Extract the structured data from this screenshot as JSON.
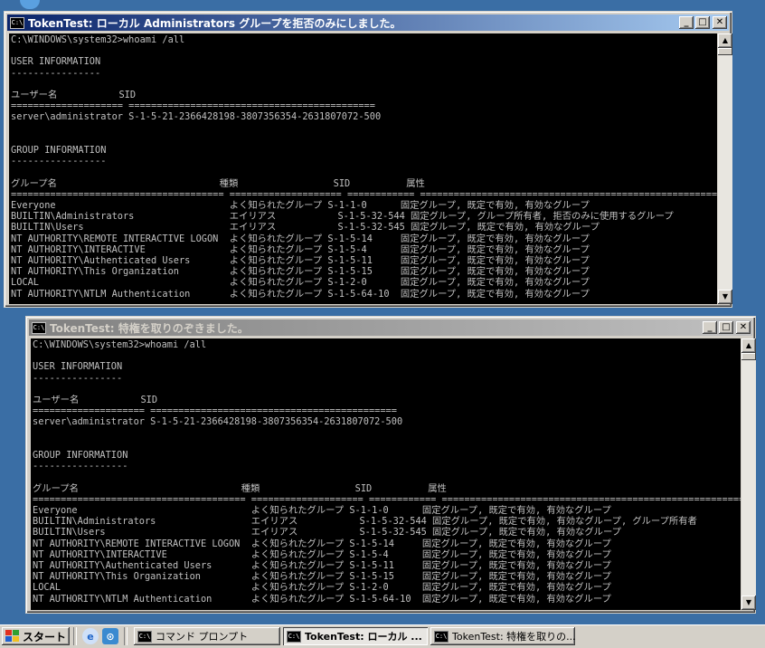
{
  "windows": [
    {
      "title": "TokenTest: ローカル Administrators グループを拒否のみにしました。",
      "active": true,
      "console_text": "C:\\WINDOWS\\system32>whoami /all\n\nUSER INFORMATION\n----------------\n\nユーザー名           SID\n==================== ============================================\nserver\\administrator S-1-5-21-2366428198-3807356354-2631807072-500\n\n\nGROUP INFORMATION\n-----------------\n\nグループ名                             種類                 SID          属性\n====================================== ==================== ============ ========================================================\nEveryone                               よく知られたグループ S-1-1-0      固定グループ, 既定で有効, 有効なグループ\nBUILTIN\\Administrators                 エイリアス           S-1-5-32-544 固定グループ, グループ所有者, 拒否のみに使用するグループ\nBUILTIN\\Users                          エイリアス           S-1-5-32-545 固定グループ, 既定で有効, 有効なグループ\nNT AUTHORITY\\REMOTE INTERACTIVE LOGON  よく知られたグループ S-1-5-14     固定グループ, 既定で有効, 有効なグループ\nNT AUTHORITY\\INTERACTIVE               よく知られたグループ S-1-5-4      固定グループ, 既定で有効, 有効なグループ\nNT AUTHORITY\\Authenticated Users       よく知られたグループ S-1-5-11     固定グループ, 既定で有効, 有効なグループ\nNT AUTHORITY\\This Organization         よく知られたグループ S-1-5-15     固定グループ, 既定で有効, 有効なグループ\nLOCAL                                  よく知られたグループ S-1-2-0      固定グループ, 既定で有効, 有効なグループ\nNT AUTHORITY\\NTLM Authentication       よく知られたグループ S-1-5-64-10  固定グループ, 既定で有効, 有効なグループ"
    },
    {
      "title": "TokenTest: 特権を取りのぞきました。",
      "active": false,
      "console_text": "C:\\WINDOWS\\system32>whoami /all\n\nUSER INFORMATION\n----------------\n\nユーザー名           SID\n==================== ============================================\nserver\\administrator S-1-5-21-2366428198-3807356354-2631807072-500\n\n\nGROUP INFORMATION\n-----------------\n\nグループ名                             種類                 SID          属性\n====================================== ==================== ============ ========================================================\nEveryone                               よく知られたグループ S-1-1-0      固定グループ, 既定で有効, 有効なグループ\nBUILTIN\\Administrators                 エイリアス           S-1-5-32-544 固定グループ, 既定で有効, 有効なグループ, グループ所有者\nBUILTIN\\Users                          エイリアス           S-1-5-32-545 固定グループ, 既定で有効, 有効なグループ\nNT AUTHORITY\\REMOTE INTERACTIVE LOGON  よく知られたグループ S-1-5-14     固定グループ, 既定で有効, 有効なグループ\nNT AUTHORITY\\INTERACTIVE               よく知られたグループ S-1-5-4      固定グループ, 既定で有効, 有効なグループ\nNT AUTHORITY\\Authenticated Users       よく知られたグループ S-1-5-11     固定グループ, 既定で有効, 有効なグループ\nNT AUTHORITY\\This Organization         よく知られたグループ S-1-5-15     固定グループ, 既定で有効, 有効なグループ\nLOCAL                                  よく知られたグループ S-1-2-0      固定グループ, 既定で有効, 有効なグループ\nNT AUTHORITY\\NTLM Authentication       よく知られたグループ S-1-5-64-10  固定グループ, 既定で有効, 有効なグループ"
    }
  ],
  "console_icon_text": "C:\\",
  "titlebar_buttons": {
    "minimize": "_",
    "maximize": "□",
    "close": "✕"
  },
  "scrollbar": {
    "up": "▲",
    "down": "▼"
  },
  "taskbar": {
    "start_label": "スタート",
    "quick_launch": [
      "ie-icon",
      "explorer-icon"
    ],
    "buttons": [
      {
        "label": "コマンド プロンプト",
        "pressed": false
      },
      {
        "label": "TokenTest: ローカル ...",
        "pressed": true
      },
      {
        "label": "TokenTest: 特権を取りの...",
        "pressed": false
      }
    ]
  },
  "colors": {
    "desktop": "#3a6ea5",
    "console_bg": "#000000",
    "console_fg": "#c0c0c0",
    "active_title": "#0a246a",
    "inactive_title": "#808080"
  }
}
